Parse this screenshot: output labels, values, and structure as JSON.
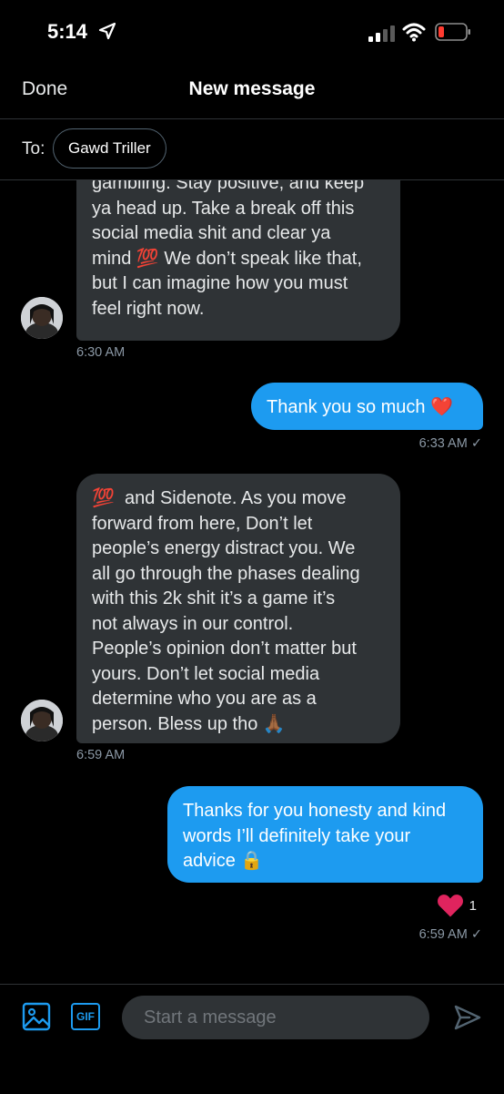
{
  "status_bar": {
    "time": "5:14"
  },
  "nav": {
    "done_label": "Done",
    "title": "New message"
  },
  "recipient": {
    "to_label": "To:",
    "name": "Gawd Triller"
  },
  "messages": [
    {
      "from": "them",
      "text": "gambling. Stay positive, and keep\nya head up. Take a break off this\nsocial media shit and clear ya\nmind 💯 We don’t speak like that,\nbut I can imagine how you must\nfeel right now.",
      "time": "6:30 AM"
    },
    {
      "from": "me",
      "text": "Thank you so much ❤️",
      "time": "6:33 AM ✓"
    },
    {
      "from": "them",
      "text": "💯  and Sidenote. As you move\nforward from here, Don’t let\npeople’s energy distract you. We\nall go through the phases dealing\nwith this 2k shit it’s a game it’s\nnot always in our control.\nPeople’s opinion don’t matter but\nyours. Don’t let social media\ndetermine who you are as a\nperson. Bless up tho 🙏🏾",
      "time": "6:59 AM"
    },
    {
      "from": "me",
      "text": "Thanks for you honesty and kind\nwords I’ll definitely take your\nadvice 🔒",
      "time": "6:59 AM ✓",
      "reaction": {
        "emoji": "❤️",
        "count": "1"
      }
    }
  ],
  "composer": {
    "placeholder": "Start a message",
    "gif_label": "GIF"
  },
  "colors": {
    "accent": "#1d9bf0",
    "incoming_bubble": "#2f3336",
    "background": "#000000",
    "reaction_heart": "#e0245e"
  }
}
